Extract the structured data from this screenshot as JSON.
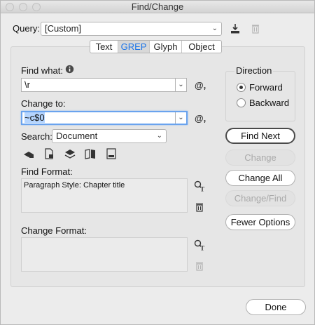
{
  "window": {
    "title": "Find/Change"
  },
  "query": {
    "label": "Query:",
    "value": "[Custom]"
  },
  "tabs": [
    {
      "label": "Text"
    },
    {
      "label": "GREP"
    },
    {
      "label": "Glyph"
    },
    {
      "label": "Object"
    }
  ],
  "find": {
    "label": "Find what:",
    "value": "\\r"
  },
  "change": {
    "label": "Change to:",
    "value": "~c$0"
  },
  "search": {
    "label": "Search:",
    "value": "Document"
  },
  "find_format": {
    "label": "Find Format:",
    "value": "Paragraph Style: Chapter title"
  },
  "change_format": {
    "label": "Change Format:",
    "value": ""
  },
  "direction": {
    "label": "Direction",
    "options": [
      {
        "label": "Forward"
      },
      {
        "label": "Backward"
      }
    ],
    "selected": "Forward"
  },
  "buttons": {
    "find_next": "Find Next",
    "change": "Change",
    "change_all": "Change All",
    "change_find": "Change/Find",
    "fewer_options": "Fewer Options",
    "done": "Done"
  },
  "special_char_glyph": "@,",
  "colors": {
    "accent": "#1a74e8",
    "focus_ring": "#6aa3ee"
  }
}
